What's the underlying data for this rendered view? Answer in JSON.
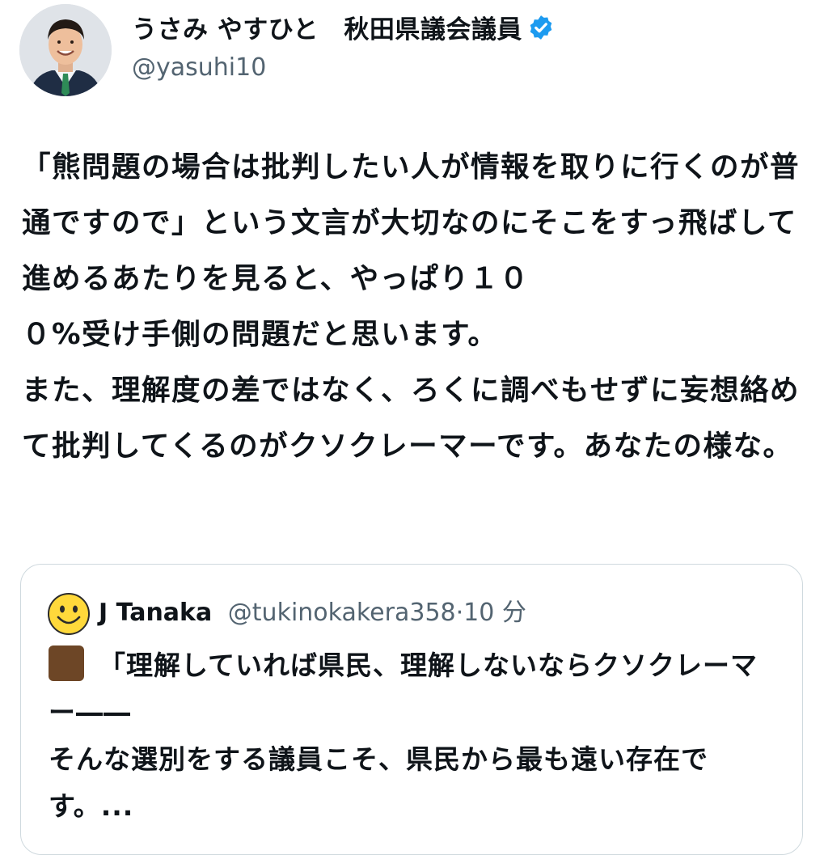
{
  "author": {
    "display_name": "うさみ やすひと　秋田県議会議員",
    "handle": "@yasuhi10",
    "verified_icon": "verified-badge-icon",
    "verified_color": "#1d9bf0"
  },
  "tweet": {
    "text": "「熊問題の場合は批判したい人が情報を取りに行くのが普通ですので」という文言が大切なのにそこをすっ飛ばして進めるあたりを見ると、やっぱり１０\n０%受け手側の問題だと思います。\nまた、理解度の差ではなく、ろくに調べもせずに妄想絡めて批判してくるのがクソクレーマーです。あなたの様な。"
  },
  "quoted_tweet": {
    "name": "J Tanaka",
    "handle": "@tukinokakera358",
    "separator": "·",
    "time": "10 分",
    "avatar_icon": "smiley-face-icon",
    "lead_icon": "brown-square-icon",
    "text": "「理解していれば県民、理解しないならクソクレーマー――\nそんな選別をする議員こそ、県民から最も遠い存在です。..."
  }
}
